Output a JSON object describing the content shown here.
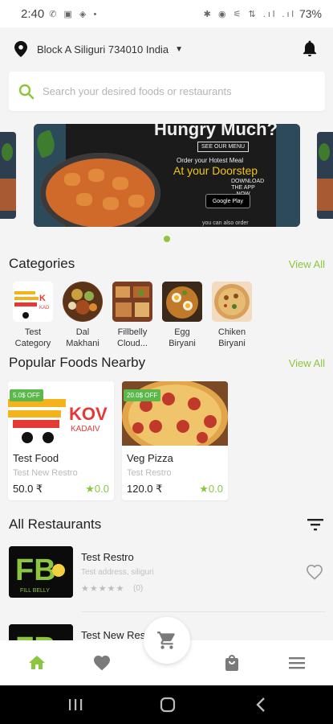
{
  "status_bar": {
    "time": "2:40",
    "left_icons": "✆ ▣ ◈ •",
    "right_icons": "✱ ◉ ⚟ ⇅ .ıl .ıl",
    "battery": "73%"
  },
  "location": {
    "address": "Block A Siliguri 734010 India"
  },
  "search": {
    "placeholder": "Search your desired foods or restaurants"
  },
  "banner": {
    "title": "Hungry Much?",
    "menu_button": "SEE OUR MENU",
    "line1": "Order your Hotest Meal",
    "line2": "At your Doorstep",
    "download": "DOWNLOAD THE APP NOW",
    "store": "Google Play",
    "footer": "you can also order"
  },
  "categories": {
    "heading": "Categories",
    "view_all": "View All",
    "items": [
      {
        "label": "Test\nCategory"
      },
      {
        "label": "Dal\nMakhani"
      },
      {
        "label": "Fillbelly\nCloud..."
      },
      {
        "label": "Egg\nBiryani"
      },
      {
        "label": "Chiken\nBiryani"
      }
    ]
  },
  "popular": {
    "heading": "Popular Foods Nearby",
    "view_all": "View All",
    "items": [
      {
        "badge": "5.0$ OFF",
        "name": "Test Food",
        "restaurant": "Test New Restro",
        "price": "50.0 ₹",
        "rating": "★0.0",
        "logo_text": "KOV",
        "logo_sub": "KADAIV"
      },
      {
        "badge": "20.0$ OFF",
        "name": "Veg Pizza",
        "restaurant": "Test Restro",
        "price": "120.0 ₹",
        "rating": "★0.0"
      }
    ]
  },
  "restaurants": {
    "heading": "All Restaurants",
    "items": [
      {
        "name": "Test Restro",
        "address": "Test address, siliguri",
        "stars": "★★★★★",
        "count": "(0)",
        "logo_text": "FB",
        "logo_sub": "FILL BELLY"
      },
      {
        "name": "Test New Res",
        "logo_text": "FB"
      }
    ]
  },
  "colors": {
    "accent": "#8cc63f",
    "badge": "#5bb84a"
  }
}
